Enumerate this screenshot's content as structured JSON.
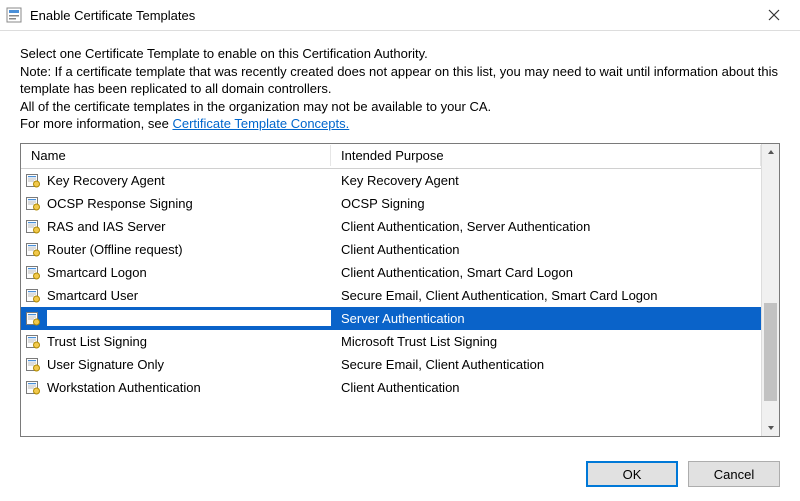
{
  "window": {
    "title": "Enable Certificate Templates"
  },
  "instructions": {
    "line1": "Select one Certificate Template to enable on this Certification Authority.",
    "line2": "Note: If a certificate template that was recently created does not appear on this list, you may need to wait until information about this template has been replicated to all domain controllers.",
    "line3": "All of the certificate templates in the organization may not be available to your CA.",
    "more_prefix": "For more information, see ",
    "more_link": "Certificate Template Concepts."
  },
  "columns": {
    "name": "Name",
    "purpose": "Intended Purpose"
  },
  "templates": [
    {
      "name": "Key Recovery Agent",
      "purpose": "Key Recovery Agent",
      "selected": false,
      "redacted": false
    },
    {
      "name": "OCSP Response Signing",
      "purpose": "OCSP Signing",
      "selected": false,
      "redacted": false
    },
    {
      "name": "RAS and IAS Server",
      "purpose": "Client Authentication, Server Authentication",
      "selected": false,
      "redacted": false
    },
    {
      "name": "Router (Offline request)",
      "purpose": "Client Authentication",
      "selected": false,
      "redacted": false
    },
    {
      "name": "Smartcard Logon",
      "purpose": "Client Authentication, Smart Card Logon",
      "selected": false,
      "redacted": false
    },
    {
      "name": "Smartcard User",
      "purpose": "Secure Email, Client Authentication, Smart Card Logon",
      "selected": false,
      "redacted": false
    },
    {
      "name": "",
      "purpose": "Server Authentication",
      "selected": true,
      "redacted": true
    },
    {
      "name": "Trust List Signing",
      "purpose": "Microsoft Trust List Signing",
      "selected": false,
      "redacted": false
    },
    {
      "name": "User Signature Only",
      "purpose": "Secure Email, Client Authentication",
      "selected": false,
      "redacted": false
    },
    {
      "name": "Workstation Authentication",
      "purpose": "Client Authentication",
      "selected": false,
      "redacted": false
    }
  ],
  "buttons": {
    "ok": "OK",
    "cancel": "Cancel"
  }
}
